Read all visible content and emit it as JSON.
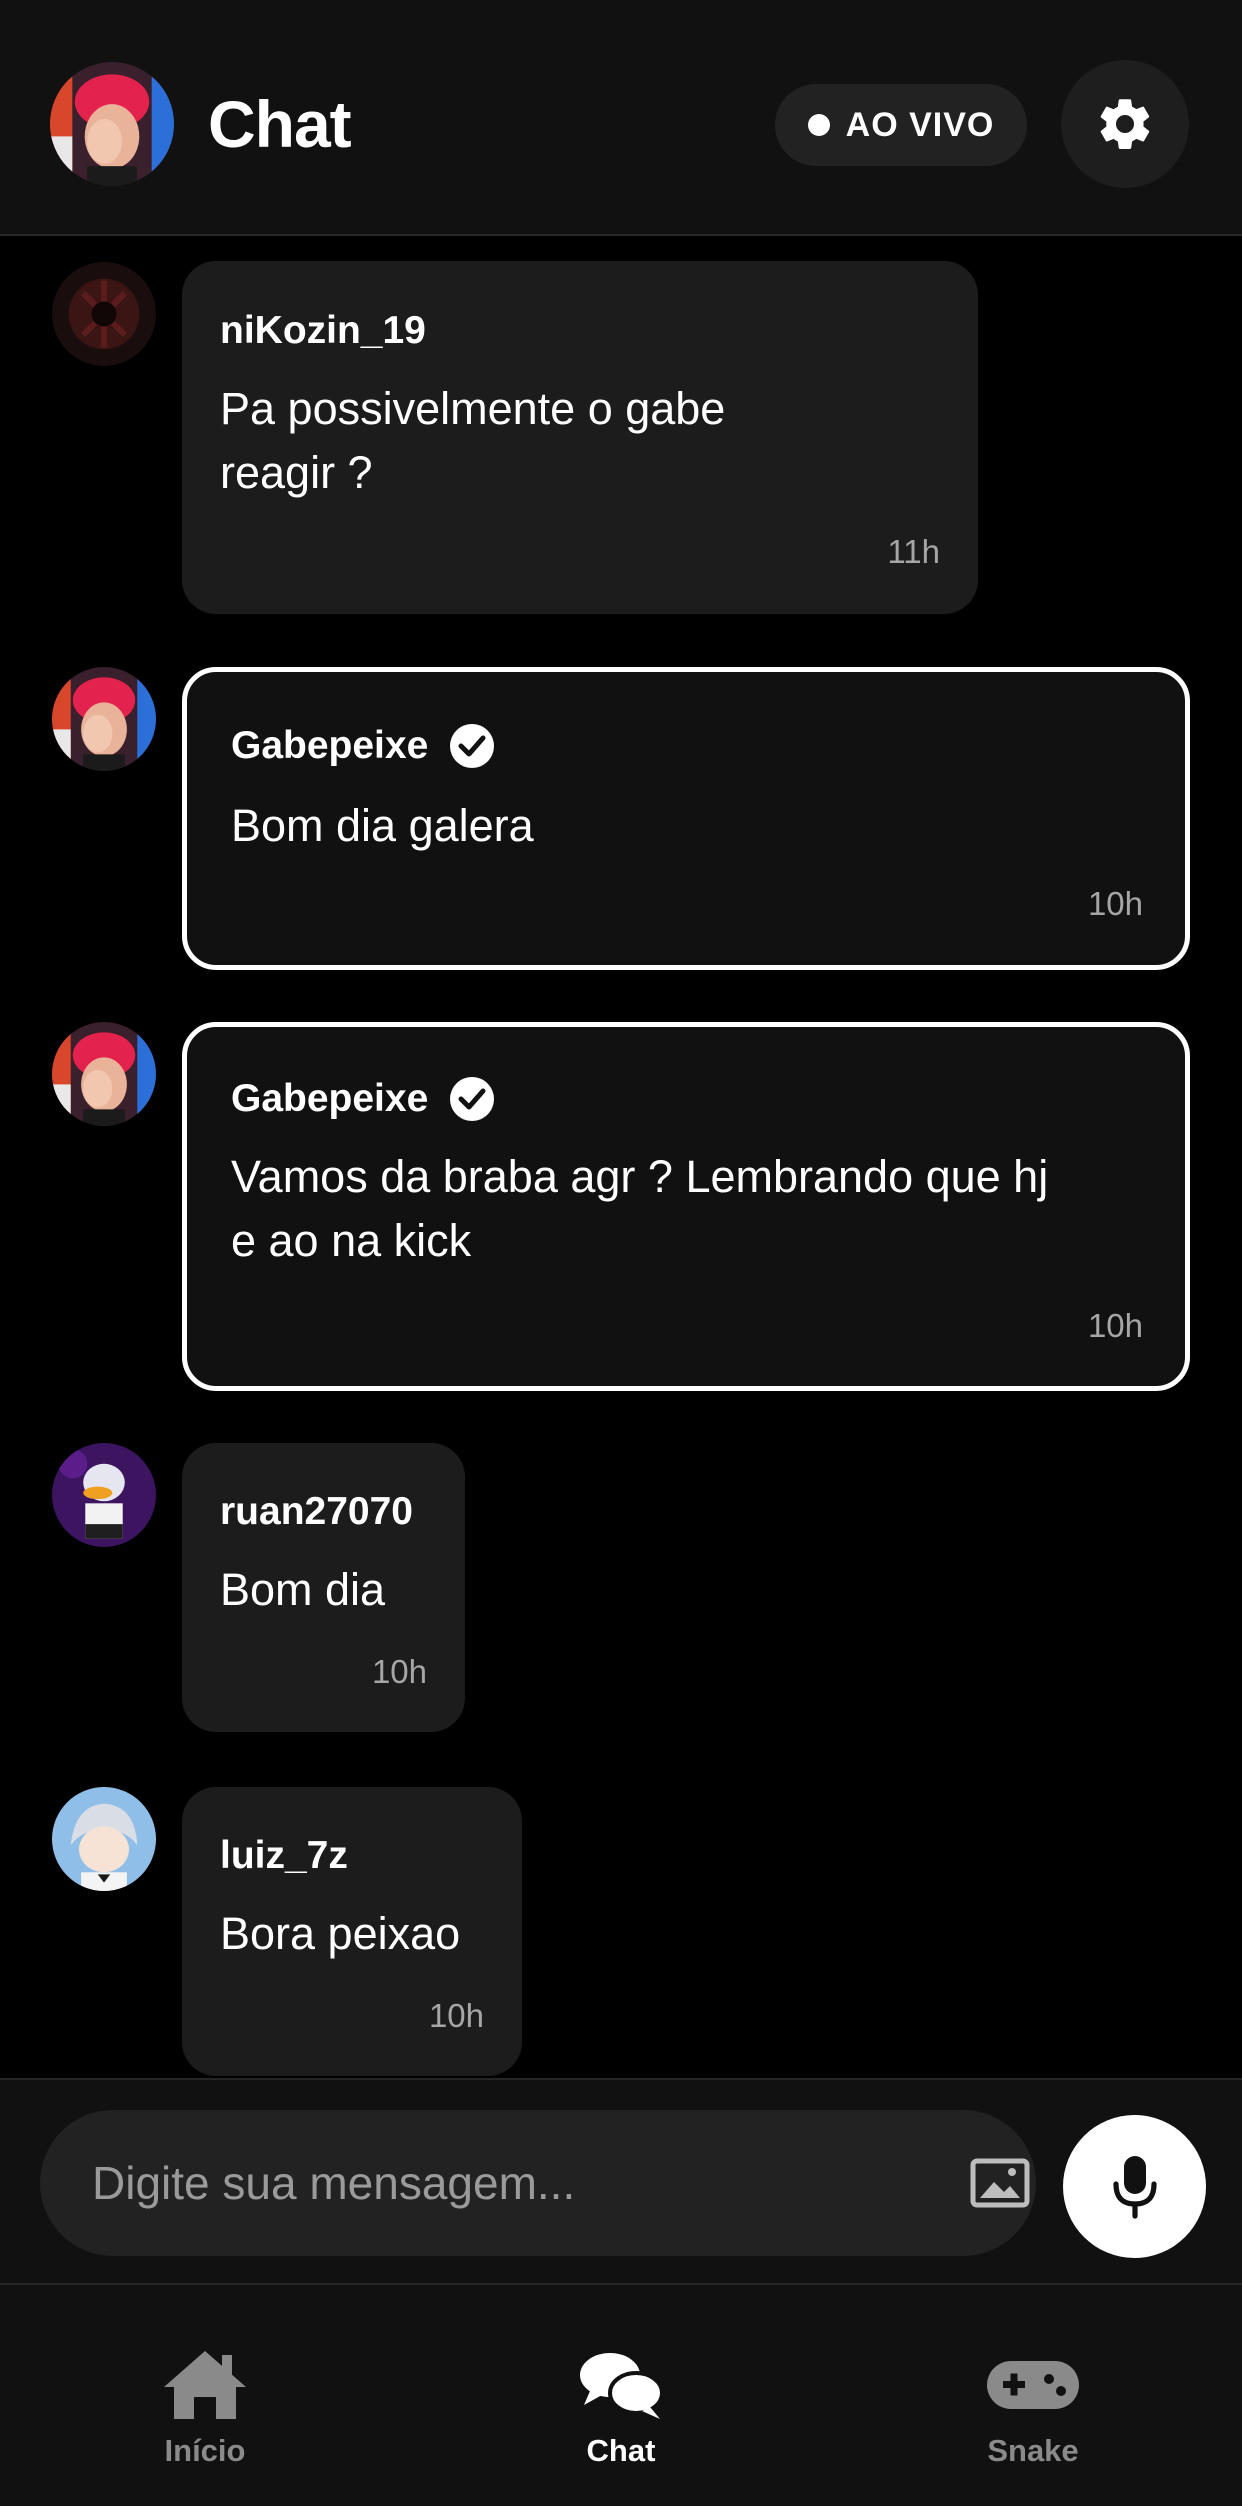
{
  "header": {
    "title": "Chat",
    "live_label": "AO VIVO",
    "avatar_icon": "streamer-avatar",
    "settings_icon": "gear-icon"
  },
  "messages": [
    {
      "username": "niKozin_19",
      "text_lines": [
        "Pa possivelmente o gabe",
        "reagir ?"
      ],
      "time": "11h",
      "verified": false,
      "avatar": "dark-red-avatar"
    },
    {
      "username": "Gabepeixe",
      "text_lines": [
        "Bom dia galera"
      ],
      "time": "10h",
      "verified": true,
      "avatar": "streamer-avatar"
    },
    {
      "username": "Gabepeixe",
      "text_lines": [
        "Vamos da braba agr ? Lembrando que hj",
        "e ao na kick"
      ],
      "time": "10h",
      "verified": true,
      "avatar": "streamer-avatar"
    },
    {
      "username": "ruan27070",
      "text_lines": [
        "Bom dia"
      ],
      "time": "10h",
      "verified": false,
      "avatar": "purple-duck-avatar"
    },
    {
      "username": "luiz_7z",
      "text_lines": [
        "Bora peixao"
      ],
      "time": "10h",
      "verified": false,
      "avatar": "anime-silver-hair-avatar"
    }
  ],
  "composer": {
    "placeholder": "Digite sua mensagem...",
    "image_icon": "image-icon",
    "mic_icon": "microphone-icon"
  },
  "nav": [
    {
      "label": "Início",
      "icon": "home-icon",
      "active": false
    },
    {
      "label": "Chat",
      "icon": "chat-bubbles-icon",
      "active": true
    },
    {
      "label": "Snake",
      "icon": "gamepad-icon",
      "active": false
    }
  ],
  "colors": {
    "background": "#000000",
    "surface": "#111111",
    "bubble": "#1c1c1c",
    "verified_border": "#ffffff",
    "muted_text": "#a6a6a6"
  }
}
